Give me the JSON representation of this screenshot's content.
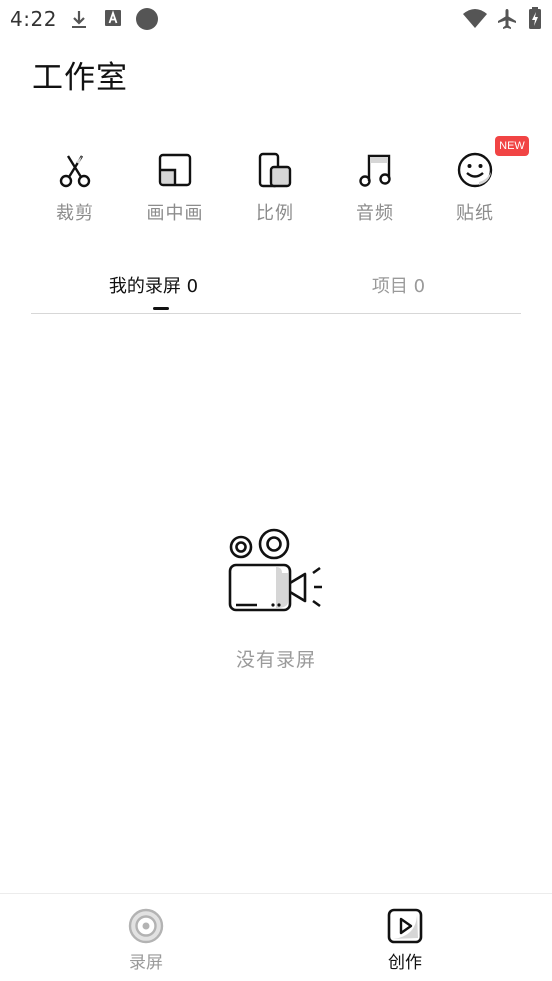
{
  "status_bar": {
    "time": "4:22",
    "icons": [
      "download-icon",
      "text-a-icon",
      "circle-dot-icon",
      "wifi-icon",
      "airplane-icon",
      "battery-charging-icon"
    ]
  },
  "header": {
    "title": "工作室"
  },
  "tools": [
    {
      "label": "裁剪",
      "icon": "scissors-icon"
    },
    {
      "label": "画中画",
      "icon": "picture-in-picture-icon"
    },
    {
      "label": "比例",
      "icon": "aspect-ratio-icon"
    },
    {
      "label": "音频",
      "icon": "music-note-icon"
    },
    {
      "label": "贴纸",
      "icon": "smiley-sticker-icon",
      "badge": "NEW"
    }
  ],
  "tabs": [
    {
      "label": "我的录屏 0",
      "active": true
    },
    {
      "label": "项目 0",
      "active": false
    }
  ],
  "empty_state": {
    "icon": "video-camera-icon",
    "text": "没有录屏"
  },
  "bottom_nav": [
    {
      "label": "录屏",
      "icon": "record-icon",
      "active": false
    },
    {
      "label": "创作",
      "icon": "play-square-icon",
      "active": true
    }
  ],
  "colors": {
    "accent": "#111111",
    "badge": "#f14444",
    "muted": "#9a9a9a"
  }
}
